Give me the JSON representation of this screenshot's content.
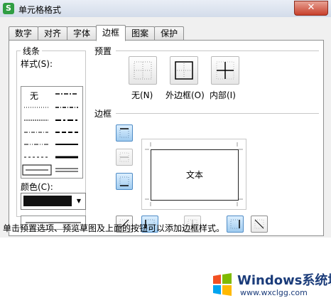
{
  "window": {
    "title": "单元格格式",
    "app_icon_text": "S",
    "close_symbol": "✕"
  },
  "tabs": [
    {
      "label": "数字"
    },
    {
      "label": "对齐"
    },
    {
      "label": "字体"
    },
    {
      "label": "边框",
      "active": true
    },
    {
      "label": "图案"
    },
    {
      "label": "保护"
    }
  ],
  "line": {
    "group_label": "线条",
    "style_label": "样式(S):",
    "none_label": "无",
    "color_label": "颜色(C):",
    "selected_color": "#111111"
  },
  "presets": {
    "group_label": "预置",
    "none_label": "无(N)",
    "outline_label": "外边框(O)",
    "inside_label": "内部(I)"
  },
  "border": {
    "group_label": "边框",
    "preview_text": "文本"
  },
  "footer_text": "单击预置选项、预览草图及上面的按钮可以添加边框样式。",
  "watermark": {
    "title": "Windows系统城",
    "url": "www.wxclgg.com"
  }
}
